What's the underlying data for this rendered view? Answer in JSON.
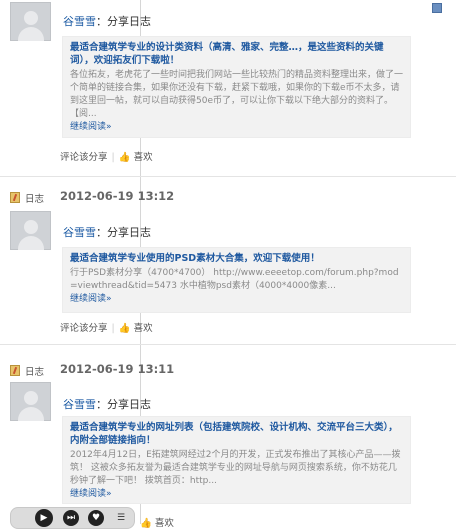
{
  "posts": [
    {
      "author": "谷雪雪",
      "action": "：分享日志",
      "title": "最适合建筑学专业的设计类资料（高清、雅家、完整…，是这些资料的关键词），欢迎拓友们下载啦！",
      "body": "各位拓友，老虎花了一些时间把我们网站一些比较热门的精品资料整理出来，做了一个简单的链接合集，如果你还没有下载，赶紧下载哦，如果你的下载e币不太多，请到这里回一帖，就可以自动获得50e币了，可以让你下载以下绝大部分的资料了。",
      "tail": "【阅...",
      "more": "继续阅读»",
      "comment": "评论该分享",
      "like": "喜欢"
    },
    {
      "date_label": "日志",
      "date": "2012-06-19 13:12",
      "author": "谷雪雪",
      "action": "：分享日志",
      "title": "最适合建筑学专业使用的PSD素材大合集，欢迎下载使用！",
      "body": "行于PSD素材分享（4700*4700） http://www.eeeetop.com/forum.php?mod=viewthread&tid=5473 水中植物psd素材（4000*4000像素...",
      "more": "继续阅读»",
      "comment": "评论该分享",
      "like": "喜欢"
    },
    {
      "date_label": "日志",
      "date": "2012-06-19 13:11",
      "author": "谷雪雪",
      "action": "：分享日志",
      "title": "最适合建筑学专业的网址列表（包括建筑院校、设计机构、交流平台三大类），内附全部链接指向！",
      "body": "2012年4月12日，E拓建筑网经过2个月的开发，正式发布推出了其核心产品——拨筑！  这被众多拓友誉为最适合建筑学专业的网址导航与网页搜索系统，你不妨花几秒钟了解一下吧！  拨筑首页：http...",
      "more": "继续阅读»",
      "like": "喜欢"
    }
  ],
  "player": {
    "buttons": [
      "play-icon",
      "next-icon",
      "heart-icon",
      "list-icon"
    ]
  }
}
